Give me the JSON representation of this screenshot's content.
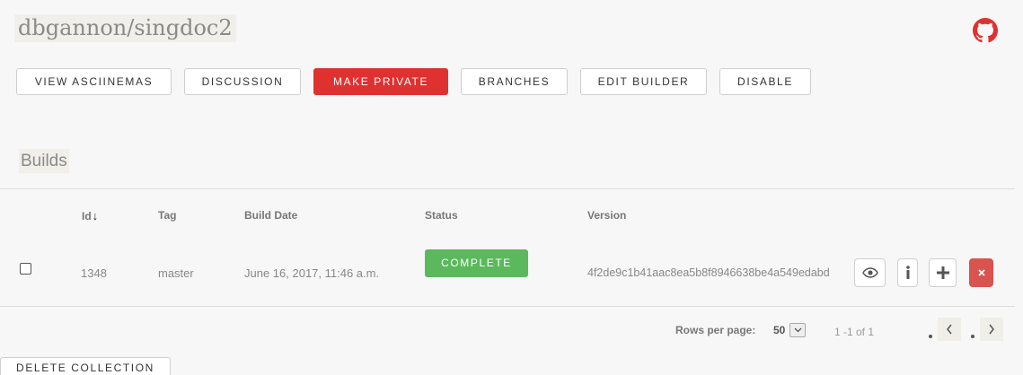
{
  "header": {
    "title": "dbgannon/singdoc2",
    "github_icon": "github-icon"
  },
  "actions": {
    "view_asciinemas": "VIEW ASCIINEMAS",
    "discussion": "DISCUSSION",
    "make_private": "MAKE PRIVATE",
    "branches": "BRANCHES",
    "edit_builder": "EDIT BUILDER",
    "disable": "DISABLE"
  },
  "builds": {
    "title": "Builds",
    "columns": {
      "id": "Id",
      "tag": "Tag",
      "build_date": "Build Date",
      "status": "Status",
      "version": "Version"
    },
    "sort": {
      "column": "id",
      "direction": "descending"
    },
    "rows": [
      {
        "id": "1348",
        "tag": "master",
        "build_date": "June 16, 2017, 11:46 a.m.",
        "status": "COMPLETE",
        "version": "4f2de9c1b41aac8ea5b8f8946638be4a549edabd",
        "selected": false
      }
    ]
  },
  "pagination": {
    "rows_per_page_label": "Rows per page:",
    "rows_per_page": "50",
    "range": "1 -1 of 1"
  },
  "footer": {
    "delete_collection": "DELETE COLLECTION"
  },
  "colors": {
    "danger": "#e03131",
    "success": "#5cb85c",
    "delete_action": "#d9534f",
    "github": "#e03131"
  },
  "icons": {
    "row_actions": [
      "eye-icon",
      "info-icon",
      "plus-icon",
      "close-icon"
    ],
    "pager": [
      "chevron-left-icon",
      "chevron-right-icon"
    ],
    "dropdown": "chevron-down-icon"
  }
}
